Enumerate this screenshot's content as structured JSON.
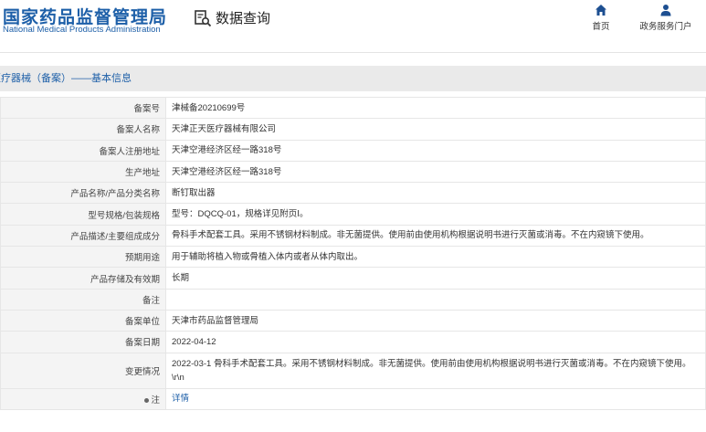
{
  "header": {
    "logo_cn": "国家药品监督管理局",
    "logo_en": "National Medical Products Administration",
    "search_title": "数据查询",
    "nav": {
      "home_label": "首页",
      "portal_label": "政务服务门户"
    }
  },
  "section": {
    "title": "医疗器械（备案）——基本信息"
  },
  "rows": [
    {
      "label": "备案号",
      "value": "津械备20210699号"
    },
    {
      "label": "备案人名称",
      "value": "天津正天医疗器械有限公司"
    },
    {
      "label": "备案人注册地址",
      "value": "天津空港经济区经一路318号"
    },
    {
      "label": "生产地址",
      "value": "天津空港经济区经一路318号"
    },
    {
      "label": "产品名称/产品分类名称",
      "value": "断钉取出器"
    },
    {
      "label": "型号规格/包装规格",
      "value": "型号：DQCQ-01，规格详见附页Ⅰ。"
    },
    {
      "label": "产品描述/主要组成成分",
      "value": "骨科手术配套工具。采用不锈钢材料制成。非无菌提供。使用前由使用机构根据说明书进行灭菌或消毒。不在内窥镜下使用。"
    },
    {
      "label": "预期用途",
      "value": "用于辅助将植入物或骨植入体内或者从体内取出。"
    },
    {
      "label": "产品存储及有效期",
      "value": "长期"
    },
    {
      "label": "备注",
      "value": ""
    },
    {
      "label": "备案单位",
      "value": "天津市药品监督管理局"
    },
    {
      "label": "备案日期",
      "value": "2022-04-12"
    },
    {
      "label": "变更情况",
      "value": "2022-03-1 骨科手术配套工具。采用不锈钢材料制成。非无菌提供。使用前由使用机构根据说明书进行灭菌或消毒。不在内窥镜下使用。\\r\\n"
    },
    {
      "label": "注",
      "value": "详情"
    }
  ]
}
